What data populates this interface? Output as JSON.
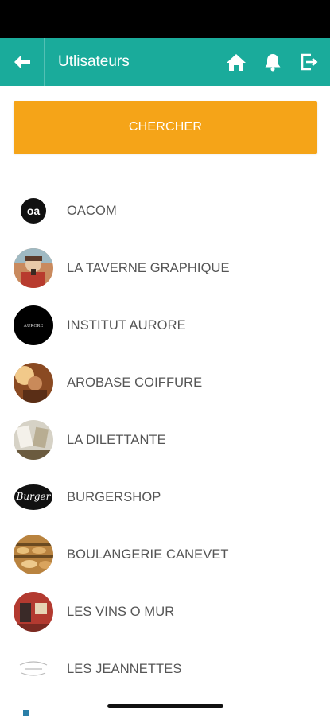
{
  "header": {
    "title": "Utlisateurs",
    "back_icon": "arrow-left-icon",
    "home_icon": "home-icon",
    "bell_icon": "bell-icon",
    "logout_icon": "logout-icon",
    "color": "#1aab9b"
  },
  "search": {
    "label": "CHERCHER",
    "color": "#f5a418"
  },
  "users": [
    {
      "name": "OACOM",
      "logo_text": "oa"
    },
    {
      "name": "LA TAVERNE GRAPHIQUE"
    },
    {
      "name": "INSTITUT AURORE",
      "logo_text": "AURORE"
    },
    {
      "name": "AROBASE COIFFURE"
    },
    {
      "name": "LA DILETTANTE"
    },
    {
      "name": "BURGERSHOP",
      "logo_text": "Burger"
    },
    {
      "name": "BOULANGERIE CANEVET"
    },
    {
      "name": "LES VINS O MUR"
    },
    {
      "name": "LES JEANNETTES"
    }
  ]
}
